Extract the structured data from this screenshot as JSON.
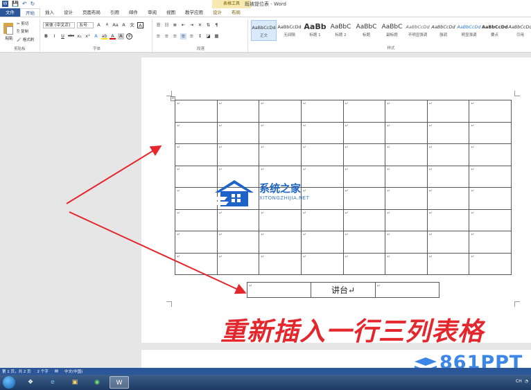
{
  "window": {
    "title": "既被提位表 - Word",
    "context_group": "表格工具"
  },
  "qat": {
    "save": "💾",
    "undo": "↶",
    "redo": "↻"
  },
  "tabs": [
    {
      "label": "文件"
    },
    {
      "label": "开始"
    },
    {
      "label": "插入"
    },
    {
      "label": "设计"
    },
    {
      "label": "页面布局"
    },
    {
      "label": "引用"
    },
    {
      "label": "邮件"
    },
    {
      "label": "审阅"
    },
    {
      "label": "视图"
    },
    {
      "label": "教学应用"
    },
    {
      "label": "设计"
    },
    {
      "label": "布局"
    }
  ],
  "ribbon": {
    "clipboard": {
      "paste": "粘贴",
      "cut": "剪切",
      "copy": "复制",
      "format_painter": "格式刷",
      "label": "剪贴板"
    },
    "font": {
      "family": "宋体 (中文正)",
      "size": "五号",
      "label": "字体",
      "grow": "A",
      "shrink": "A",
      "case": "Aa",
      "clear": "A",
      "pinyin": "文",
      "border": "A",
      "bold": "B",
      "italic": "I",
      "underline": "U",
      "strike": "abc",
      "sub": "x₂",
      "sup": "x²",
      "effect": "A",
      "highlight": "ab",
      "color": "A",
      "shade": "A",
      "circle": "字"
    },
    "paragraph": {
      "label": "段落"
    },
    "styles": {
      "label": "样式",
      "items": [
        {
          "preview": "AaBbCcDd",
          "name": "正文"
        },
        {
          "preview": "AaBbCcDd",
          "name": "无间隔"
        },
        {
          "preview": "AaBb",
          "name": "标题 1"
        },
        {
          "preview": "AaBbC",
          "name": "标题 2"
        },
        {
          "preview": "AaBbC",
          "name": "标题"
        },
        {
          "preview": "AaBbC",
          "name": "副标题"
        },
        {
          "preview": "AaBbCcDd",
          "name": "不明显强调"
        },
        {
          "preview": "AaBbCcDd",
          "name": "强调"
        },
        {
          "preview": "AaBbCcDd",
          "name": "明显强调"
        },
        {
          "preview": "AaBbCcDd",
          "name": "要点"
        },
        {
          "preview": "AaBbCcDd",
          "name": "引用"
        }
      ]
    }
  },
  "document": {
    "para_mark": "↵",
    "move_handle": "✛",
    "main_table": {
      "rows": 8,
      "cols": 8
    },
    "new_row": {
      "cells": [
        "↵",
        "讲台↵",
        "↵"
      ]
    },
    "annotation": "重新插入一行三列表格"
  },
  "watermarks": {
    "site_title": "系统之家",
    "site_sub": "XITONGZHIJIA.NET",
    "brand": "861PPT"
  },
  "statusbar": {
    "page": "第 1 页，共 2 页",
    "words": "2 个字",
    "lang": "中文(中国)"
  },
  "taskbar": {
    "word": "W",
    "tray": "CH"
  },
  "colors": {
    "word_blue": "#2b579a",
    "annotation_red": "#e4262d",
    "watermark_blue": "#1e64c8"
  }
}
